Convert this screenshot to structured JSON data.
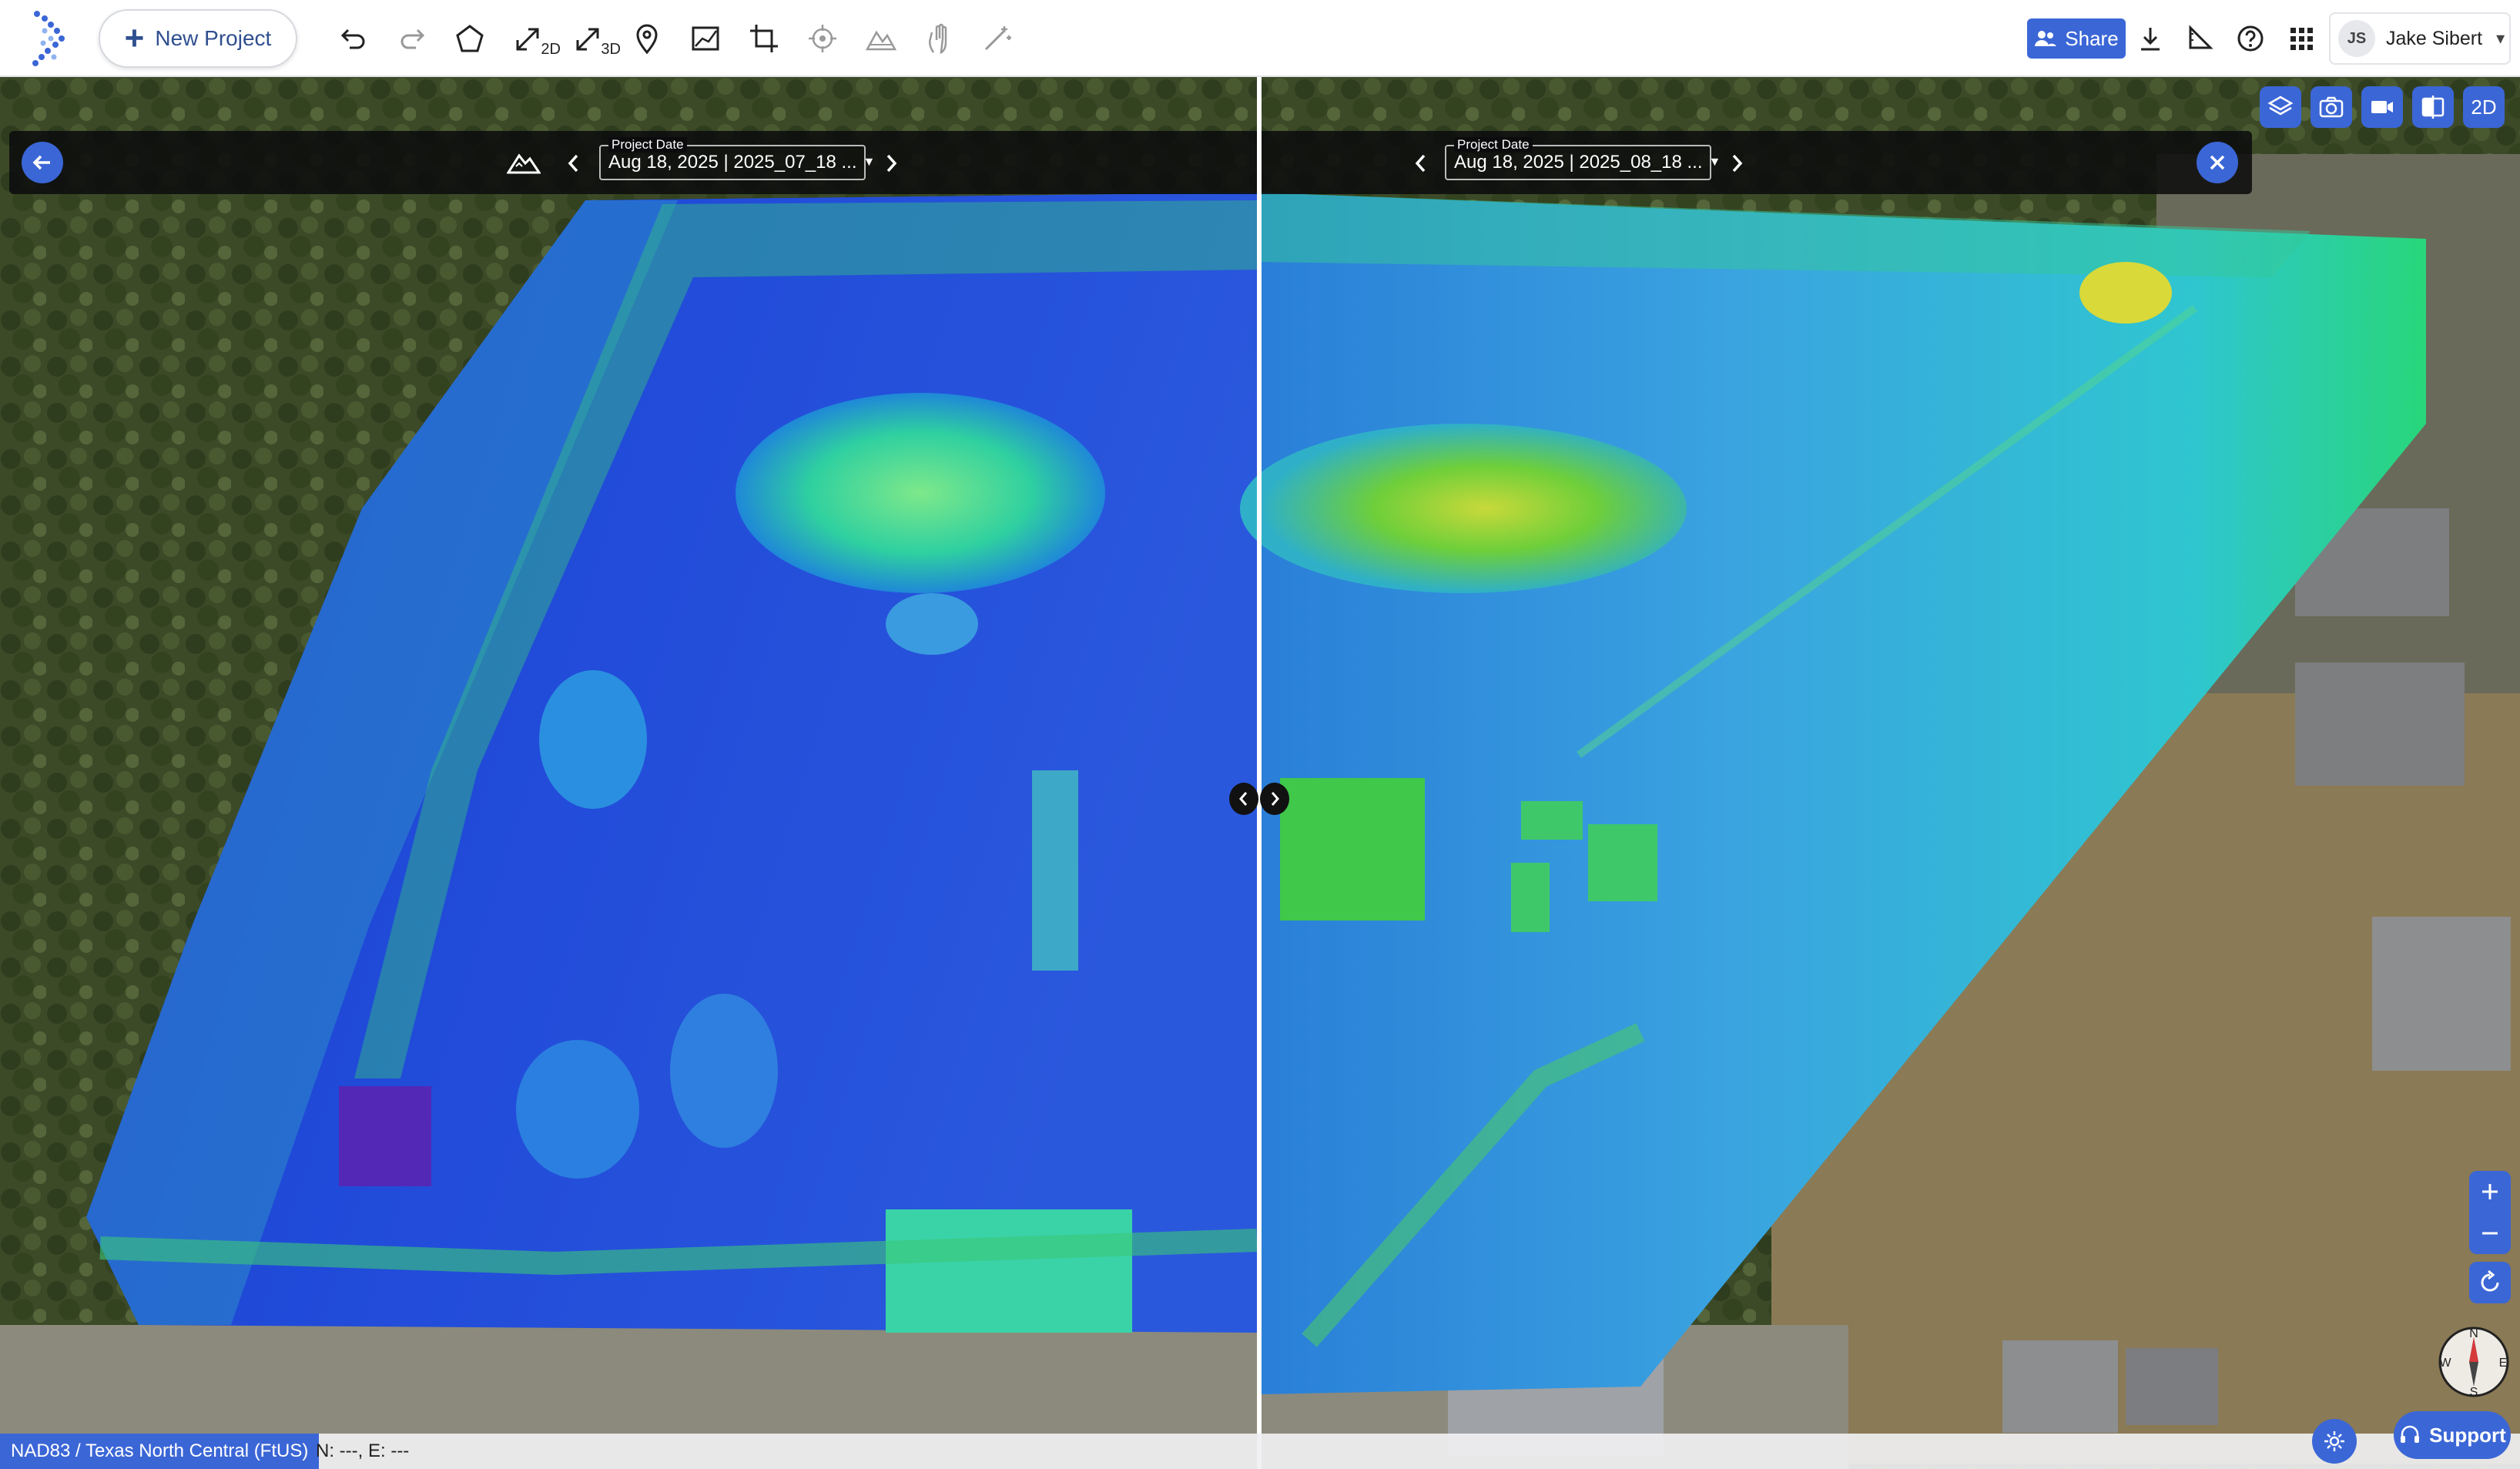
{
  "toolbar": {
    "new_project_label": "New Project",
    "tools": [
      {
        "name": "undo-icon"
      },
      {
        "name": "redo-icon"
      },
      {
        "name": "polygon-icon"
      },
      {
        "name": "measure-2d-icon",
        "suffix": "2D"
      },
      {
        "name": "measure-3d-icon",
        "suffix": "3D"
      },
      {
        "name": "location-pin-icon"
      },
      {
        "name": "profile-chart-icon"
      },
      {
        "name": "crop-icon"
      },
      {
        "name": "target-icon"
      },
      {
        "name": "volume-icon"
      },
      {
        "name": "hand-icon"
      },
      {
        "name": "wand-icon"
      }
    ],
    "suffix_2d": "2D",
    "suffix_3d": "3D"
  },
  "header": {
    "share_label": "Share",
    "user_initials": "JS",
    "user_name": "Jake Sibert"
  },
  "compare": {
    "left": {
      "label": "Project Date",
      "value": "Aug 18, 2025 | 2025_07_18 ..."
    },
    "right": {
      "label": "Project Date",
      "value": "Aug 18, 2025 | 2025_08_18 ..."
    }
  },
  "view_controls": {
    "mode_label": "2D"
  },
  "compass": {
    "n": "N",
    "s": "S",
    "e": "E",
    "w": "W"
  },
  "status": {
    "crs": "NAD83 / Texas North Central (FtUS)",
    "coords": "N: ---, E: ---"
  },
  "support_label": "Support",
  "colors": {
    "accent": "#3b66d6",
    "brand": "#2f4f8f"
  }
}
